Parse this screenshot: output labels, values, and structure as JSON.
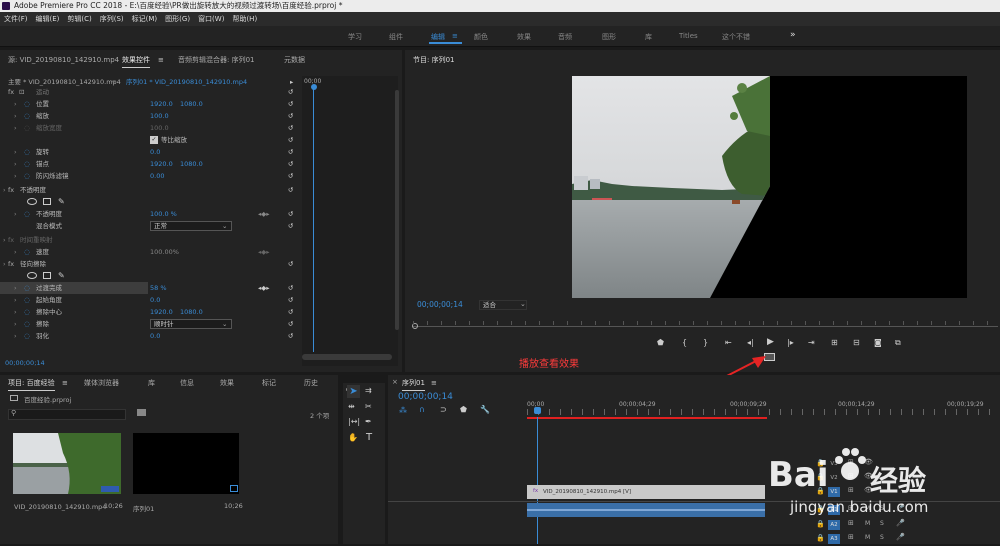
{
  "titlebar": {
    "title": "Adobe Premiere Pro CC 2018 - E:\\百度经验\\PR做出旋转放大的视频过渡转场\\百度经验.prproj *"
  },
  "menu": [
    "文件(F)",
    "编辑(E)",
    "剪辑(C)",
    "序列(S)",
    "标记(M)",
    "图形(G)",
    "窗口(W)",
    "帮助(H)"
  ],
  "workspaces": [
    "学习",
    "组件",
    "编辑",
    "颜色",
    "效果",
    "音频",
    "图形",
    "库",
    "Titles",
    "这个不错",
    "»"
  ],
  "effects_panel": {
    "tabs": [
      "源: VID_20190810_142910.mp4",
      "效果控件",
      "音频剪辑混合器: 序列01",
      "元数据"
    ],
    "master": "主要 * VID_20190810_142910.mp4",
    "seq": "序列01 * VID_20190810_142910.mp4",
    "mini_time": "00;00",
    "timecode": "00;00;00;14",
    "sections": {
      "motion": "运动",
      "opacity": "不透明度",
      "time_remap": "时间重映射",
      "wipe": "径向擦除"
    },
    "props": {
      "position": {
        "label": "位置",
        "v1": "1920.0",
        "v2": "1080.0"
      },
      "scale": {
        "label": "缩放",
        "v1": "100.0"
      },
      "scale_width": {
        "label": "缩放宽度",
        "v1": "100.0"
      },
      "uniform": {
        "label": "等比缩放"
      },
      "rotation": {
        "label": "旋转",
        "v1": "0.0"
      },
      "anchor": {
        "label": "锚点",
        "v1": "1920.0",
        "v2": "1080.0"
      },
      "anti_flicker": {
        "label": "防闪烁滤镜",
        "v1": "0.00"
      },
      "opacity": {
        "label": "不透明度",
        "v1": "100.0 %"
      },
      "blend": {
        "label": "混合模式",
        "value": "正常"
      },
      "speed": {
        "label": "速度",
        "v1": "100.00%"
      },
      "transition": {
        "label": "过渡完成",
        "v1": "58 %"
      },
      "start_angle": {
        "label": "起始角度",
        "v1": "0.0"
      },
      "wipe_center": {
        "label": "擦除中心",
        "v1": "1920.0",
        "v2": "1080.0"
      },
      "wipe": {
        "label": "擦除",
        "value": "顺时针"
      },
      "feather": {
        "label": "羽化",
        "v1": "0.0"
      }
    }
  },
  "program": {
    "title": "节目: 序列01",
    "timecode": "00;00;00;14",
    "fit": "适合"
  },
  "annotation": "播放查看效果",
  "project": {
    "tabs": [
      "项目: 百度经验",
      "媒体浏览器",
      "库",
      "信息",
      "效果",
      "标记",
      "历史"
    ],
    "file": "百度经验.prproj",
    "count": "2 个项",
    "items": [
      {
        "name": "VID_20190810_142910.mp4",
        "dur": "10;26"
      },
      {
        "name": "序列01",
        "dur": "10;26"
      }
    ]
  },
  "timeline": {
    "tab": "序列01",
    "timecode": "00;00;00;14",
    "ruler": [
      "00;00",
      "00;00;04;29",
      "00;00;09;29",
      "00;00;14;29",
      "00;00;19;29"
    ],
    "video_tracks": [
      "V3",
      "V2",
      "V1"
    ],
    "audio_tracks": [
      "A1",
      "A2",
      "A3"
    ],
    "clip": "VID_20190810_142910.mp4 [V]"
  },
  "watermark": {
    "brand": "Bai",
    "brand_cn": "经验",
    "url": "jingyan.baidu.com"
  }
}
